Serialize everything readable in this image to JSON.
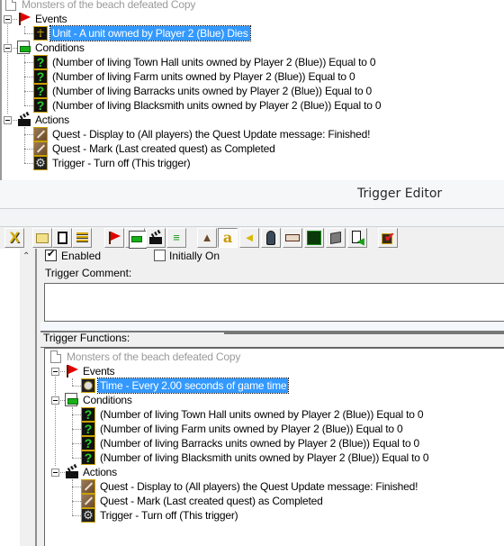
{
  "top_tree": {
    "root": "Monsters of the beach defeated Copy",
    "events_label": "Events",
    "event": "Unit - A unit owned by Player 2 (Blue) Dies",
    "conditions_label": "Conditions",
    "conditions": [
      "(Number of living Town Hall units owned by Player 2 (Blue)) Equal to 0",
      "(Number of living Farm units owned by Player 2 (Blue)) Equal to 0",
      "(Number of living Barracks units owned by Player 2 (Blue)) Equal to 0",
      "(Number of living Blacksmith units owned by Player 2 (Blue)) Equal to 0"
    ],
    "actions_label": "Actions",
    "actions": [
      "Quest - Display to (All players) the Quest Update message: Finished!",
      "Quest - Mark (Last created quest) as Completed",
      "Trigger - Turn off (This trigger)"
    ]
  },
  "window": {
    "title": "Trigger Editor"
  },
  "toolbar": {
    "buttons": [
      {
        "name": "close-x",
        "icon": "x-icon"
      },
      {
        "name": "open-folder",
        "icon": "folder-icon"
      },
      {
        "name": "new-document",
        "icon": "document-icon"
      },
      {
        "name": "new-category",
        "icon": "list-icon"
      },
      {
        "name": "new-event",
        "icon": "flag-icon"
      },
      {
        "name": "new-condition",
        "icon": "condition-icon"
      },
      {
        "name": "new-action",
        "icon": "clapboard-icon"
      },
      {
        "name": "checklist",
        "icon": "checklist-icon"
      },
      {
        "name": "terrain-editor",
        "icon": "mountain-icon"
      },
      {
        "name": "trigger-editor",
        "icon": "letter-a-icon"
      },
      {
        "name": "sound-editor",
        "icon": "speaker-icon"
      },
      {
        "name": "object-editor",
        "icon": "helmet-icon"
      },
      {
        "name": "campaign-editor",
        "icon": "cards-icon"
      },
      {
        "name": "ai-editor",
        "icon": "face-icon"
      },
      {
        "name": "import-manager",
        "icon": "box-icon"
      },
      {
        "name": "script-editor",
        "icon": "export-icon"
      },
      {
        "name": "test-map",
        "icon": "checkbox-icon"
      }
    ]
  },
  "properties": {
    "enabled_label": "Enabled",
    "enabled_checked": true,
    "initially_on_label": "Initially On",
    "initially_on_checked": false,
    "comment_label": "Trigger Comment:",
    "comment_value": "",
    "functions_label": "Trigger Functions:"
  },
  "bottom_tree": {
    "root": "Monsters of the beach defeated Copy",
    "events_label": "Events",
    "event": "Time - Every 2.00 seconds of game time",
    "conditions_label": "Conditions",
    "conditions": [
      "(Number of living Town Hall units owned by Player 2 (Blue)) Equal to 0",
      "(Number of living Farm units owned by Player 2 (Blue)) Equal to 0",
      "(Number of living Barracks units owned by Player 2 (Blue)) Equal to 0",
      "(Number of living Blacksmith units owned by Player 2 (Blue)) Equal to 0"
    ],
    "actions_label": "Actions",
    "actions": [
      "Quest - Display to (All players) the Quest Update message: Finished!",
      "Quest - Mark (Last created quest) as Completed",
      "Trigger - Turn off (This trigger)"
    ]
  }
}
